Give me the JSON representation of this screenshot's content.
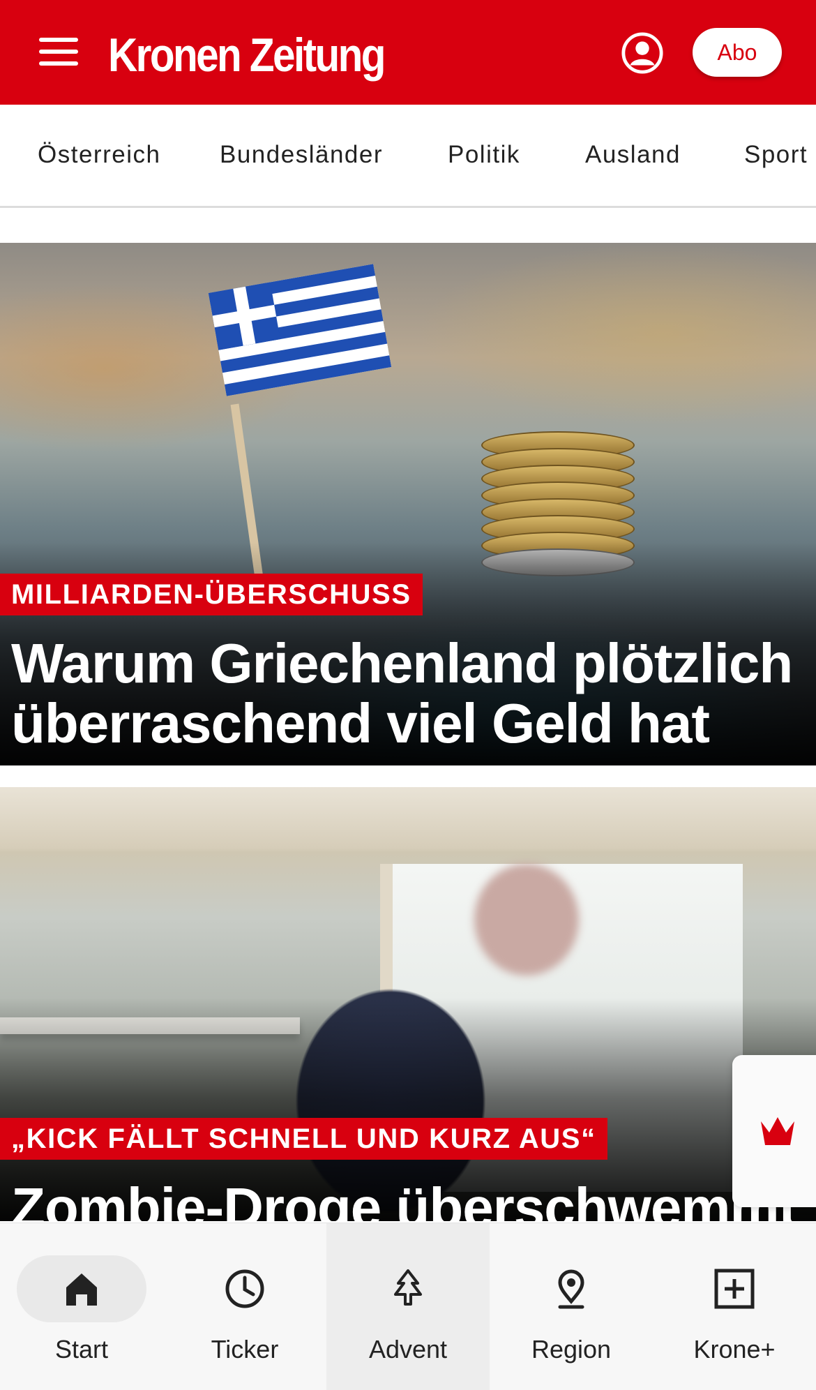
{
  "header": {
    "brand": "Kronen Zeitung",
    "abo_label": "Abo",
    "brand_color": "#d8000f",
    "icons": [
      "menu-icon",
      "account-icon"
    ]
  },
  "categories": [
    "Österreich",
    "Bundesländer",
    "Politik",
    "Ausland",
    "Sport"
  ],
  "articles": [
    {
      "kicker": "MILLIARDEN-ÜBERSCHUSS",
      "headline": "Warum Griechenland plötzlich überraschend viel Geld hat"
    },
    {
      "kicker": "„KICK FÄLLT SCHNELL UND KURZ AUS“",
      "headline": "Zombie-Droge überschwemmt"
    }
  ],
  "fab": {
    "icon": "crown-icon"
  },
  "bottom_nav": [
    {
      "label": "Start",
      "icon": "home-icon"
    },
    {
      "label": "Ticker",
      "icon": "clock-icon"
    },
    {
      "label": "Advent",
      "icon": "tree-icon"
    },
    {
      "label": "Region",
      "icon": "location-pin-icon"
    },
    {
      "label": "Krone+",
      "icon": "plus-box-icon"
    }
  ]
}
